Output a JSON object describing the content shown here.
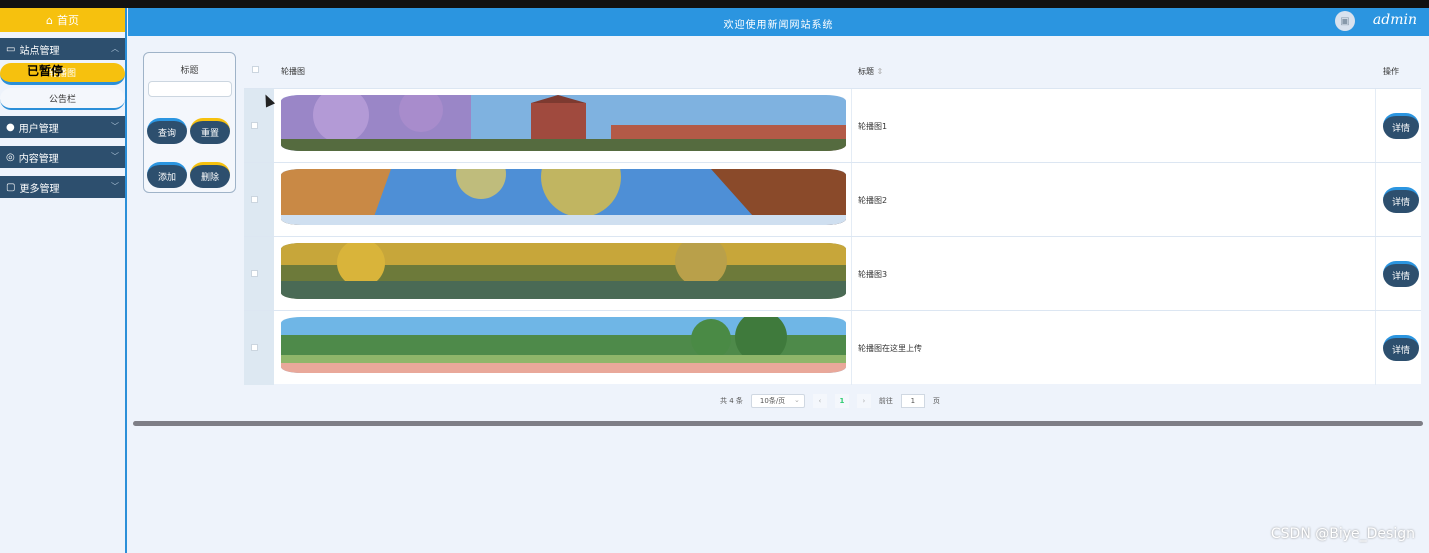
{
  "sidebar": {
    "home_label": "首页",
    "groups": [
      {
        "label": "站点管理",
        "items": [
          "轮播图",
          "公告栏"
        ]
      },
      {
        "label": "用户管理"
      },
      {
        "label": "内容管理"
      },
      {
        "label": "更多管理"
      }
    ],
    "paused_overlay": "已暂停"
  },
  "header": {
    "title": "欢迎使用新闻网站系统",
    "username": "admin"
  },
  "search": {
    "field_label": "标题",
    "query_button": "查询",
    "reset_button": "重置",
    "add_button": "添加",
    "delete_button": "删除"
  },
  "table": {
    "columns": [
      "轮播图",
      "标题",
      "操作"
    ],
    "rows": [
      {
        "title": "轮播图1",
        "action": "详情"
      },
      {
        "title": "轮播图2",
        "action": "详情"
      },
      {
        "title": "轮播图3",
        "action": "详情"
      },
      {
        "title": "轮播图在这里上传",
        "action": "详情"
      }
    ]
  },
  "pagination": {
    "total": "共 4 条",
    "page_size": "10条/页",
    "current_page": "1",
    "goto_label": "前往",
    "goto_value": "1",
    "page_unit": "页"
  },
  "watermark": "CSDN @Biye_Design",
  "colors": {
    "accent_blue": "#2b95e0",
    "accent_yellow": "#f6c10e",
    "dark_button": "#2d4f6e"
  }
}
